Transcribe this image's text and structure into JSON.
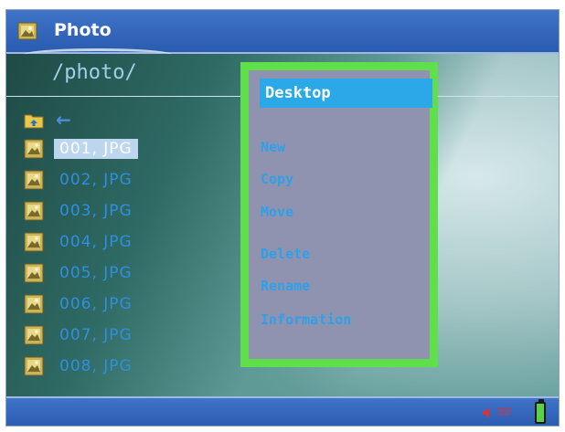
{
  "title": "Photo",
  "path": "/photo/",
  "files": [
    {
      "name": "001, JPG",
      "selected": true
    },
    {
      "name": "002, JPG",
      "selected": false
    },
    {
      "name": "003, JPG",
      "selected": false
    },
    {
      "name": "004, JPG",
      "selected": false
    },
    {
      "name": "005, JPG",
      "selected": false
    },
    {
      "name": "006, JPG",
      "selected": false
    },
    {
      "name": "007, JPG",
      "selected": false
    },
    {
      "name": "008, JPG",
      "selected": false
    }
  ],
  "menu": {
    "header": "Desktop",
    "items": [
      "New",
      "Copy",
      "Move",
      "Delete",
      "Rename",
      "Information"
    ]
  },
  "status": {
    "volume": "30"
  },
  "icons": {
    "app": "photo-app-icon",
    "folder_up": "folder-up-icon",
    "file": "jpg-file-icon",
    "volume": "speaker-icon",
    "battery": "battery-icon"
  },
  "colors": {
    "accent_blue": "#2a5cb0",
    "menu_border": "#5fe04a",
    "menu_header": "#2aa8e8",
    "file_text": "#2f8fe0"
  }
}
